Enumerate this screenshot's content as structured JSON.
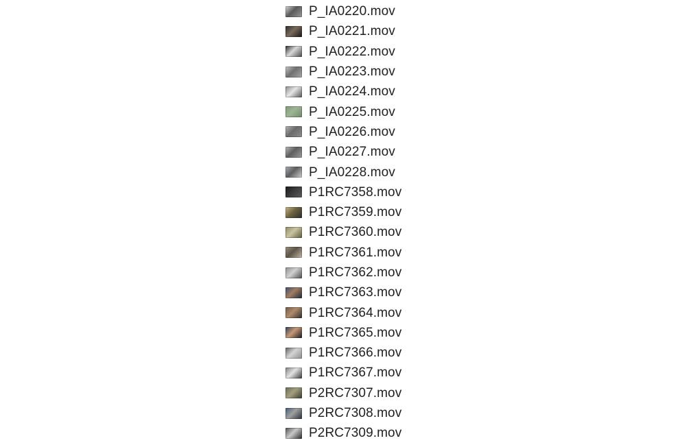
{
  "files": [
    {
      "name": "P_IA0220.mov",
      "thumb": [
        "#d9d9d9",
        "#5a5a5a",
        "#9a9a9a"
      ]
    },
    {
      "name": "P_IA0221.mov",
      "thumb": [
        "#2b2b2b",
        "#7a6a5a",
        "#151515"
      ]
    },
    {
      "name": "P_IA0222.mov",
      "thumb": [
        "#2a2a2a",
        "#d8d8d8",
        "#4a4a4a"
      ]
    },
    {
      "name": "P_IA0223.mov",
      "thumb": [
        "#c8c8c8",
        "#6f6f6f",
        "#a8a8a8"
      ]
    },
    {
      "name": "P_IA0224.mov",
      "thumb": [
        "#8a8a8a",
        "#e6e6e6",
        "#555555"
      ]
    },
    {
      "name": "P_IA0225.mov",
      "thumb": [
        "#7f9a78",
        "#9fb496",
        "#6e8a6a"
      ]
    },
    {
      "name": "P_IA0226.mov",
      "thumb": [
        "#b7b7b7",
        "#6b6b6b",
        "#8e8e8e"
      ]
    },
    {
      "name": "P_IA0227.mov",
      "thumb": [
        "#bcbcbc",
        "#5e5e5e",
        "#9d9d9d"
      ]
    },
    {
      "name": "P_IA0228.mov",
      "thumb": [
        "#a9b0b8",
        "#5e5e5e",
        "#d0d0d0"
      ]
    },
    {
      "name": "P1RC7358.mov",
      "thumb": [
        "#1a1a1a",
        "#3a3a3a",
        "#5c5c5c"
      ]
    },
    {
      "name": "P1RC7359.mov",
      "thumb": [
        "#c9b98b",
        "#6f6340",
        "#2c2c2c"
      ]
    },
    {
      "name": "P1RC7360.mov",
      "thumb": [
        "#8c8a64",
        "#c9c3a0",
        "#5b5b3c"
      ]
    },
    {
      "name": "P1RC7361.mov",
      "thumb": [
        "#9a8f7c",
        "#5d5549",
        "#c4b8a2"
      ]
    },
    {
      "name": "P1RC7362.mov",
      "thumb": [
        "#8f8f8f",
        "#d0d0d0",
        "#4d4d4d"
      ]
    },
    {
      "name": "P1RC7363.mov",
      "thumb": [
        "#3a4f6e",
        "#a37d63",
        "#1f2a3a"
      ]
    },
    {
      "name": "P1RC7364.mov",
      "thumb": [
        "#6b5a4a",
        "#b08b6a",
        "#2d2d2d"
      ]
    },
    {
      "name": "P1RC7365.mov",
      "thumb": [
        "#2d3d57",
        "#c79876",
        "#1a1a1a"
      ]
    },
    {
      "name": "P1RC7366.mov",
      "thumb": [
        "#5d5d5d",
        "#d4d4d4",
        "#8c8c8c"
      ]
    },
    {
      "name": "P1RC7367.mov",
      "thumb": [
        "#7d7d7d",
        "#e2e2e2",
        "#3a3a3a"
      ]
    },
    {
      "name": "P2RC7307.mov",
      "thumb": [
        "#6a6a58",
        "#a39f7d",
        "#3b3b31"
      ]
    },
    {
      "name": "P2RC7308.mov",
      "thumb": [
        "#3f5a76",
        "#a0a0a0",
        "#27313d"
      ]
    },
    {
      "name": "P2RC7309.mov",
      "thumb": [
        "#4f4f4f",
        "#c8c8c8",
        "#2a2a2a"
      ]
    }
  ]
}
